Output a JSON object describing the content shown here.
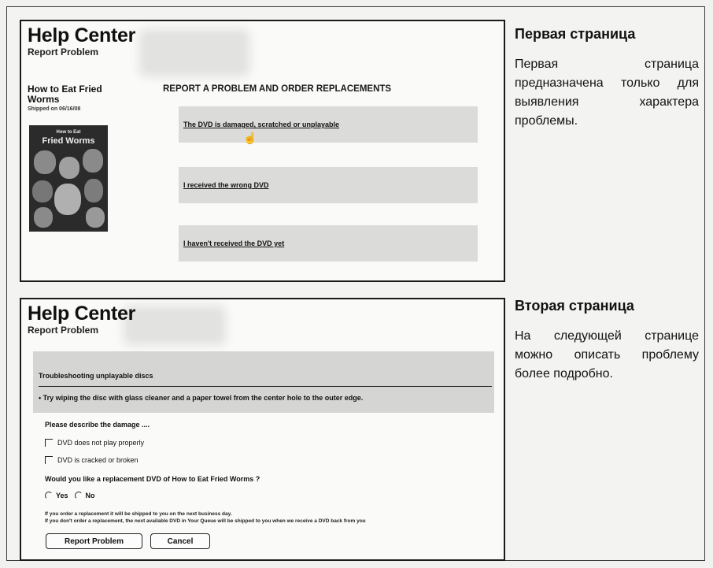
{
  "screen1": {
    "help_center": "Help Center",
    "report_problem": "Report Problem",
    "movie_title": "How to Eat Fried Worms",
    "shipped": "Shipped on 06/16/08",
    "poster_small": "How to Eat",
    "poster_title": "Fried Worms",
    "heading": "REPORT A PROBLEM AND ORDER REPLACEMENTS",
    "options": [
      "The DVD is damaged, scratched or unplayable",
      "I received the wrong DVD",
      "I haven't received the DVD yet"
    ]
  },
  "screen2": {
    "help_center": "Help Center",
    "report_problem": "Report Problem",
    "troubleshoot_title": "Troubleshooting unplayable discs",
    "troubleshoot_tip": "• Try wiping the disc with glass cleaner and a paper towel from the center hole to the outer edge.",
    "describe_label": "Please describe the damage ....",
    "checkbox1": "DVD does not play properly",
    "checkbox2": "DVD is cracked or broken",
    "replacement_question": "Would you like a replacement DVD of How to Eat Fried Worms ?",
    "yes": "Yes",
    "no": "No",
    "note1": "If you order a replacement it will be shipped to you on the next business day.",
    "note2": "If you don't order a replacement, the next available DVD in Your Queue will be shipped to you when we receive a DVD back from you",
    "report_button": "Report Problem",
    "cancel_button": "Cancel"
  },
  "side": {
    "first_heading": "Первая страница",
    "first_text": "Первая страница предназначена только для выявления характера проблемы.",
    "second_heading": "Вторая страница",
    "second_text": "На следующей странице можно описать проблему более подробно."
  }
}
